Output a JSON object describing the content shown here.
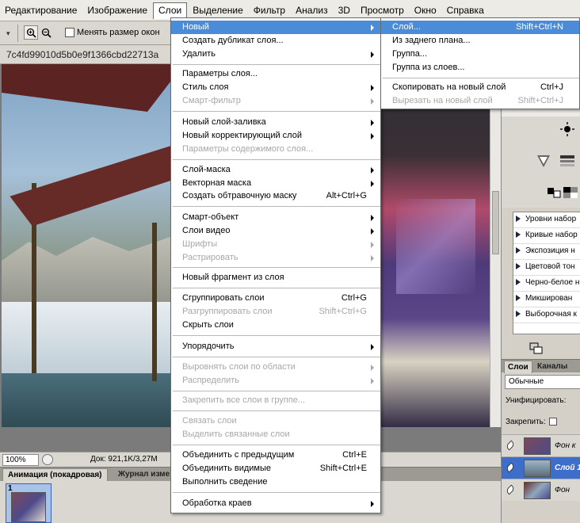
{
  "menubar": {
    "items": [
      "Редактирование",
      "Изображение",
      "Слои",
      "Выделение",
      "Фильтр",
      "Анализ",
      "3D",
      "Просмотр",
      "Окно",
      "Справка"
    ]
  },
  "options": {
    "resize_windows_label": "Менять размер окон"
  },
  "document": {
    "tab_title": "7c4fd99010d5b0e9f1366cbd22713a",
    "zoom": "100%",
    "doc_info": "Док: 921,1K/3,27M"
  },
  "animation": {
    "tab_label": "Анимация (покадровая)",
    "history_tab_label": "Журнал изме",
    "frame_number": "1"
  },
  "layers_menu": {
    "items": {
      "new": "Новый",
      "duplicate": "Создать дубликат слоя...",
      "delete": "Удалить",
      "properties": "Параметры слоя...",
      "style": "Стиль слоя",
      "smart_filter": "Смарт-фильтр",
      "new_fill": "Новый слой-заливка",
      "new_adjustment": "Новый корректирующий слой",
      "content_options": "Параметры содержимого слоя...",
      "layer_mask": "Слой-маска",
      "vector_mask": "Векторная маска",
      "clipping_mask": "Создать обтравочную маску",
      "smart_object": "Смарт-объект",
      "video_layers": "Слои видео",
      "type": "Шрифты",
      "rasterize": "Растрировать",
      "new_slice": "Новый фрагмент из слоя",
      "group": "Сгруппировать слои",
      "ungroup": "Разгруппировать слои",
      "hide": "Скрыть слои",
      "arrange": "Упорядочить",
      "align": "Выровнять слои по области",
      "distribute": "Распределить",
      "lock_all": "Закрепить все слои в группе...",
      "link": "Связать слои",
      "select_linked": "Выделить связанные слои",
      "merge_down": "Объединить с предыдущим",
      "merge_visible": "Объединить видимые",
      "flatten": "Выполнить сведение",
      "matting": "Обработка краев"
    },
    "shortcuts": {
      "clipping_mask": "Alt+Ctrl+G",
      "group": "Ctrl+G",
      "ungroup": "Shift+Ctrl+G",
      "merge_down": "Ctrl+E",
      "merge_visible": "Shift+Ctrl+E"
    }
  },
  "new_submenu": {
    "layer": "Слой...",
    "layer_sc": "Shift+Ctrl+N",
    "from_background": "Из заднего плана...",
    "group": "Группа...",
    "group_from_layers": "Группа из слоев...",
    "copy_to_new": "Скопировать на новый слой",
    "copy_to_new_sc": "Ctrl+J",
    "cut_to_new": "Вырезать на новый слой",
    "cut_to_new_sc": "Shift+Ctrl+J"
  },
  "adjustments": {
    "presets": [
      "Уровни набор",
      "Кривые набор",
      "Экспозиция н",
      "Цветовой тон",
      "Черно-белое н",
      "Микширован",
      "Выборочная к"
    ]
  },
  "layers_panel": {
    "tab_layers": "Слои",
    "tab_channels": "Каналы",
    "blend_mode": "Обычные",
    "unify_label": "Унифицировать:",
    "lock_label": "Закрепить:",
    "layers": [
      {
        "name": "Фон к"
      },
      {
        "name": "Слой 1"
      },
      {
        "name": "Фон"
      }
    ]
  },
  "colors": {
    "highlight": "#4b8cd9",
    "selected_layer": "#3e6ecb"
  }
}
